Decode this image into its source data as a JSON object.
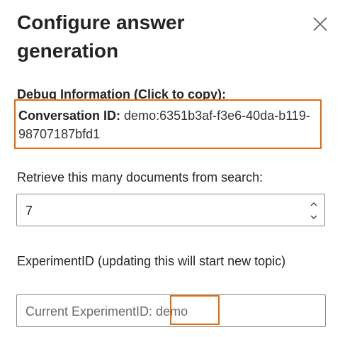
{
  "panel": {
    "title": "Configure answer generation",
    "close_icon": "close-icon"
  },
  "debug": {
    "heading": "Debug Information (Click to copy):",
    "conversation_label": "Conversation ID:",
    "conversation_id": "demo:6351b3af-f3e6-40da-b119-98707187bfd1",
    "highlight_color": "#e46c0a"
  },
  "retrieve": {
    "label": "Retrieve this many documents from search:",
    "value": "7",
    "up_icon": "chevron-up-icon",
    "down_icon": "chevron-down-icon"
  },
  "experiment": {
    "label": "ExperimentID (updating this will start new topic)",
    "placeholder": "Current ExperimentID: demo"
  }
}
